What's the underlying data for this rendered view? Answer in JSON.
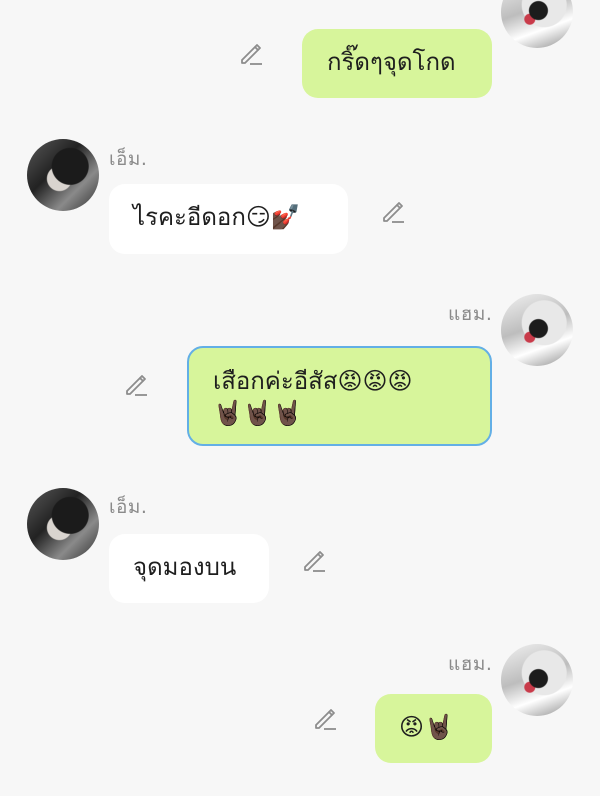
{
  "messages": [
    {
      "sender": "",
      "side": "right",
      "text": "กริ๊ดๆจุดโกด"
    },
    {
      "sender": "เอ็ม.",
      "side": "left",
      "text": "ไรคะอีดอก😏💅🏿"
    },
    {
      "sender": "แฮม.",
      "side": "right",
      "text": "เสือกค่ะอีสัส😡😡😡\n🤘🏿🤘🏿🤘🏿",
      "selected": true
    },
    {
      "sender": "เอ็ม.",
      "side": "left",
      "text": "จุดมองบน"
    },
    {
      "sender": "แฮม.",
      "side": "right",
      "text": "😡🤘🏿"
    }
  ],
  "icons": {
    "edit": "pencil-edit-icon",
    "avatar_em": "avatar",
    "avatar_ham": "avatar"
  },
  "colors": {
    "background": "#f7f7f7",
    "outgoing_bubble": "#d7f59b",
    "incoming_bubble": "#ffffff",
    "selected_border": "#63afe6",
    "sender_name": "#8a8a8a"
  }
}
